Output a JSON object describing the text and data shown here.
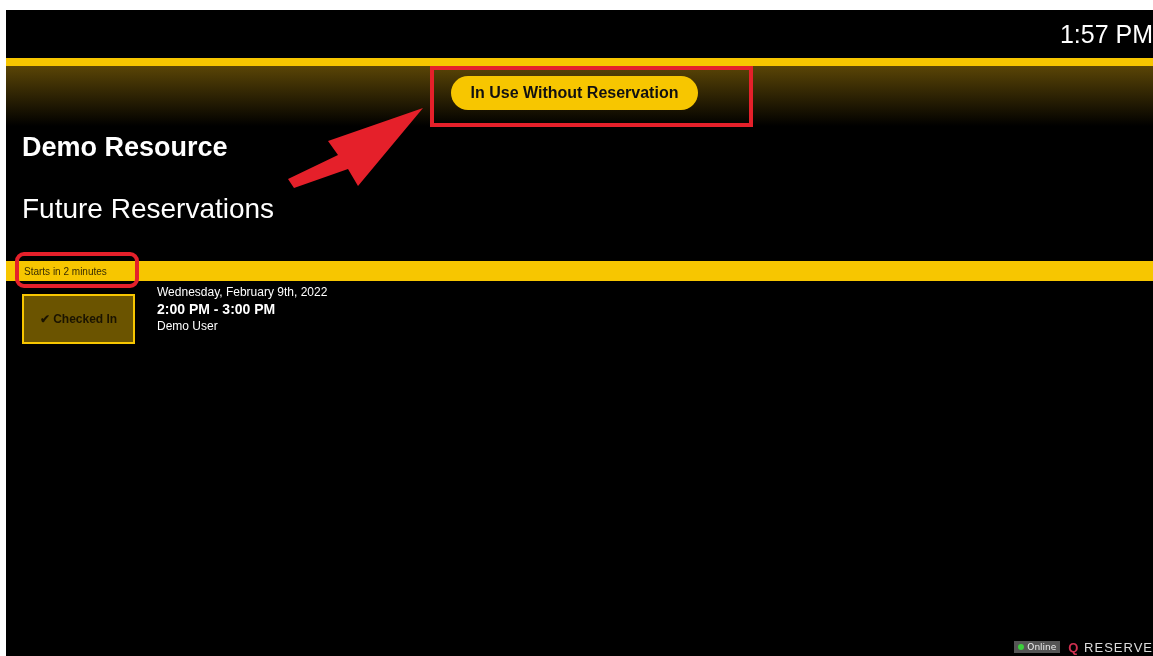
{
  "header": {
    "time": "1:57 PM"
  },
  "status": {
    "label": "In Use Without Reservation"
  },
  "resource": {
    "title": "Demo Resource"
  },
  "section": {
    "title": "Future Reservations"
  },
  "reservations": [
    {
      "countdown": "Starts in 2 minutes",
      "checked_in": true,
      "button": "✔ Checked In",
      "date": "Wednesday, February 9th, 2022",
      "time": "2:00 PM - 3:00 PM",
      "user": "Demo User"
    }
  ],
  "footer": {
    "connection": "Online",
    "online": true,
    "logo_mark": "Q",
    "logo_text": "RESERVE"
  }
}
